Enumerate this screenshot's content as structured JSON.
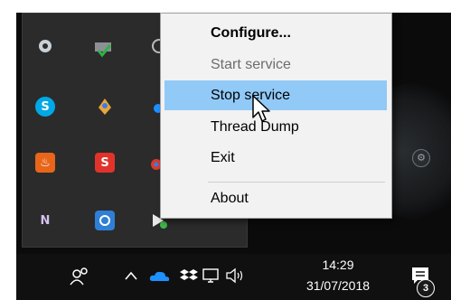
{
  "context_menu": {
    "items": [
      {
        "label": "Configure...",
        "state": "default-bold"
      },
      {
        "label": "Start service",
        "state": "disabled"
      },
      {
        "label": "Stop service",
        "state": "highlighted"
      },
      {
        "label": "Thread Dump",
        "state": "normal"
      },
      {
        "label": "Exit",
        "state": "normal"
      },
      {
        "label": "About",
        "state": "normal"
      }
    ]
  },
  "tray_icons": [
    {
      "name": "satellite-icon"
    },
    {
      "name": "drive-check-icon"
    },
    {
      "name": "partial-app-icon"
    },
    {
      "name": "skype-icon",
      "glyph": "S"
    },
    {
      "name": "maps-pin-icon"
    },
    {
      "name": "blue-dot-icon"
    },
    {
      "name": "java-icon"
    },
    {
      "name": "scribble-s-icon",
      "glyph": "S"
    },
    {
      "name": "chrome-icon"
    },
    {
      "name": "onenote-icon",
      "glyph": "N"
    },
    {
      "name": "sync-icon"
    },
    {
      "name": "service-tray-icon"
    }
  ],
  "taskbar": {
    "time": "14:29",
    "date": "31/07/2018",
    "notification_count": "3"
  },
  "colors": {
    "menu_highlight": "#91c9f7",
    "taskbar_bg": "#101010",
    "flyout_bg": "#2b2b2b"
  }
}
